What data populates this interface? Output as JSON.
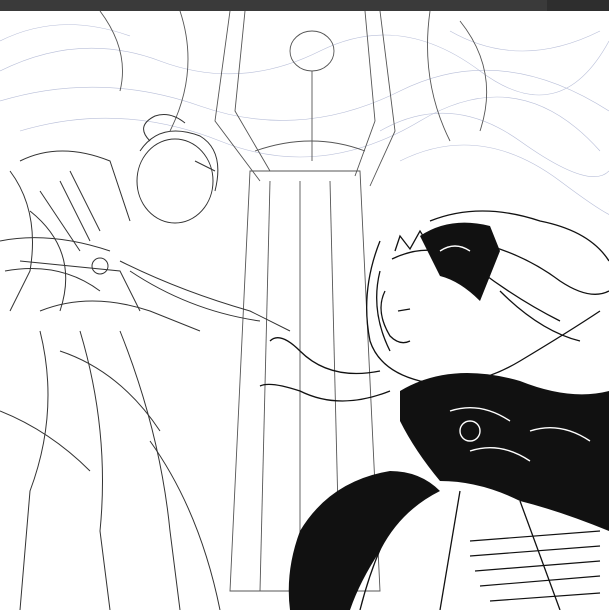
{
  "app": {
    "top_bar_color": "#3a3a3a",
    "canvas_color": "#ffffff"
  },
  "artwork": {
    "kind": "ink line-art illustration (work in progress)",
    "figures": [
      {
        "id": "left-figure",
        "icon": "sketch-figure",
        "style": "rough pencil sketch"
      },
      {
        "id": "right-figure",
        "icon": "inked-figure",
        "style": "inked with crown and black cape"
      },
      {
        "id": "background-figure",
        "icon": "background-sketch",
        "style": "faint construction lines"
      }
    ],
    "ink_color": "#111111",
    "sketch_color": "#555555",
    "guide_color": "#9aa3c8"
  }
}
